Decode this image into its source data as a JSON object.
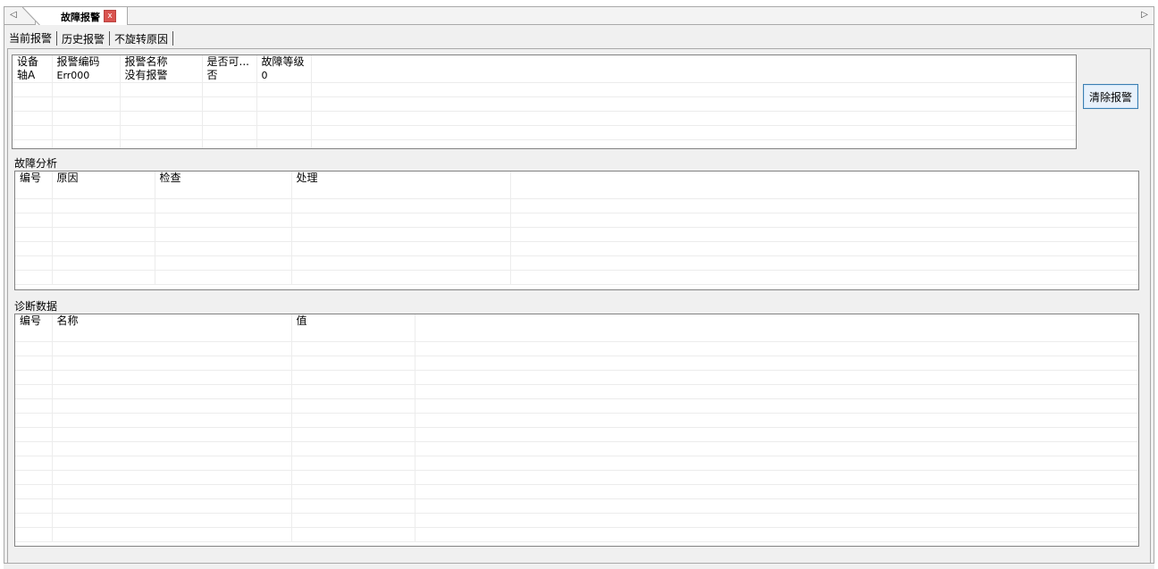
{
  "doc_tab": {
    "title": "故障报警",
    "close": "x"
  },
  "nav": {
    "left": "◁",
    "right": "▷"
  },
  "subtabs": [
    "当前报警",
    "历史报警",
    "不旋转原因"
  ],
  "current_alarms": {
    "columns": [
      "设备",
      "报警编码",
      "报警名称",
      "是否可...",
      "故障等级"
    ],
    "rows": [
      [
        "轴A",
        "Err000",
        "没有报警",
        "否",
        "0"
      ]
    ]
  },
  "clear_button": {
    "label": "清除报警"
  },
  "fault_analysis": {
    "label": "故障分析",
    "columns": [
      "编号",
      "原因",
      "检查",
      "处理"
    ]
  },
  "diagnostic_data": {
    "label": "诊断数据",
    "columns": [
      "编号",
      "名称",
      "值"
    ]
  }
}
